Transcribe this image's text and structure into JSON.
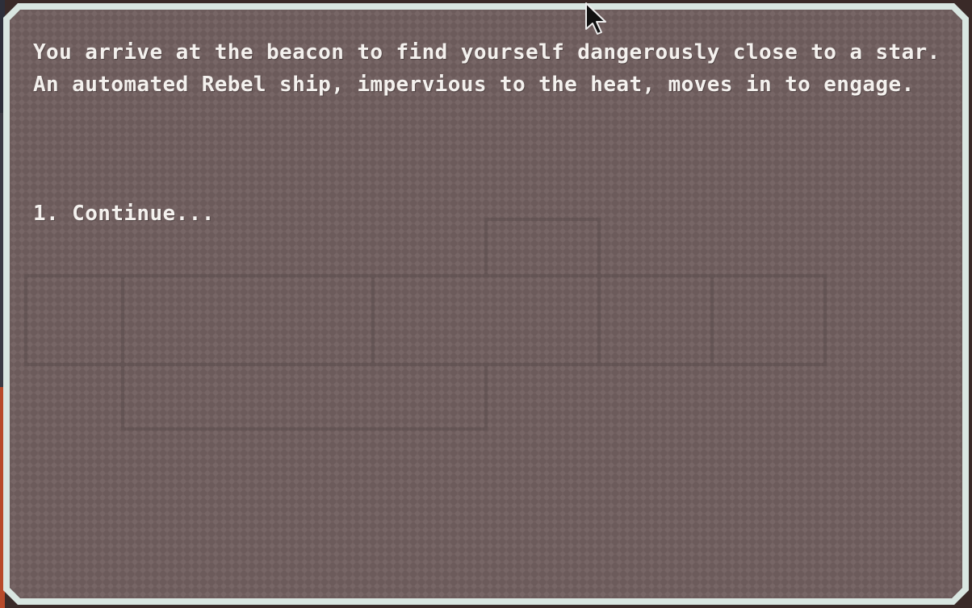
{
  "event": {
    "text": "You arrive at the beacon to find yourself dangerously close to a star. An automated Rebel ship, impervious to the heat, moves in to engage."
  },
  "choices": [
    {
      "label": "1. Continue..."
    }
  ],
  "colors": {
    "panel_fill": "#726060",
    "panel_border": "#d9e6e1",
    "text": "#f4f1ee"
  },
  "icons": {
    "cursor": "mouse-pointer-icon"
  }
}
